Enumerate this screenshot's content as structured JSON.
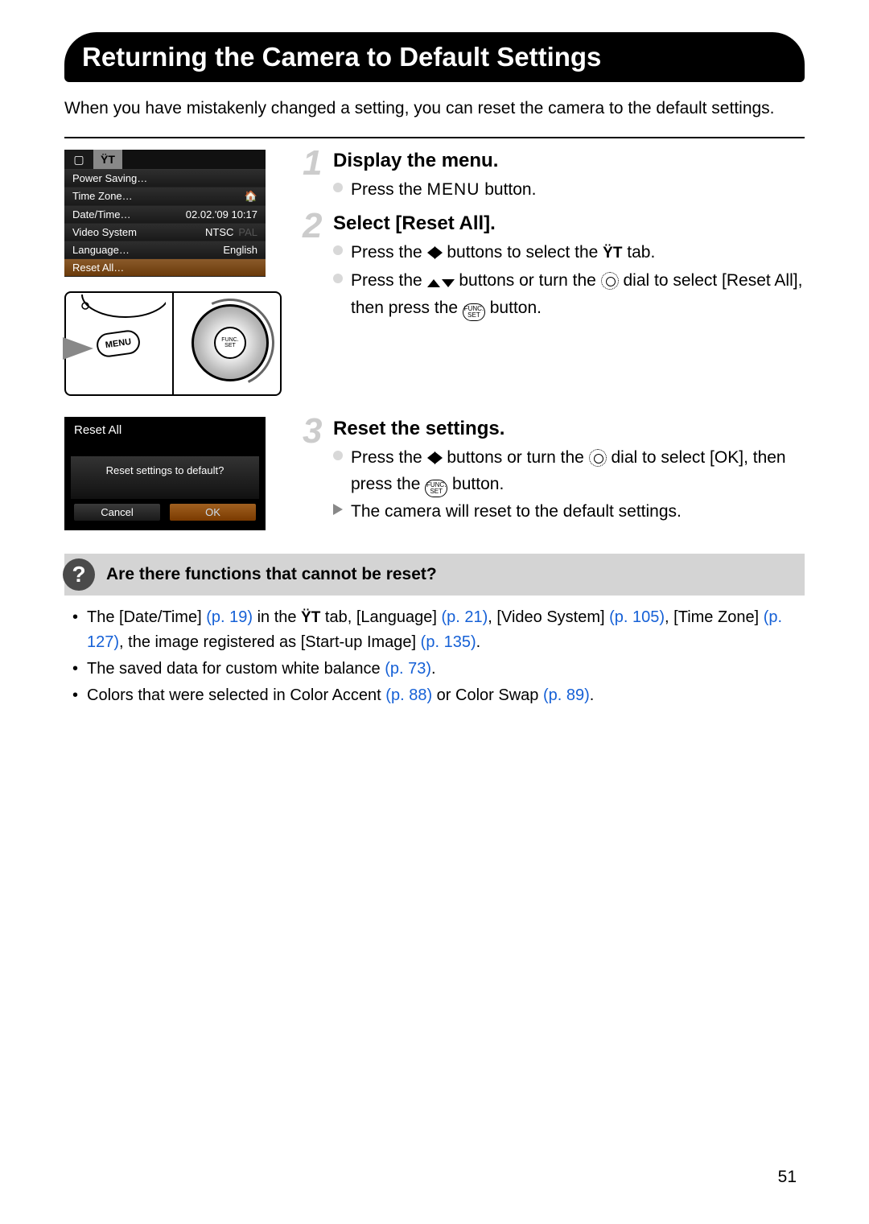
{
  "title": "Returning the Camera to Default Settings",
  "intro": "When you have mistakenly changed a setting, you can reset the camera to the default settings.",
  "page_number": "51",
  "cam_menu": {
    "rows": [
      {
        "label": "Power Saving…",
        "value": ""
      },
      {
        "label": "Time Zone…",
        "value": "🏠"
      },
      {
        "label": "Date/Time…",
        "value": "02.02.'09 10:17"
      },
      {
        "label": "Video System",
        "value": "NTSC",
        "dim": "PAL"
      },
      {
        "label": "Language…",
        "value": "English"
      },
      {
        "label": "Reset All…",
        "value": "",
        "selected": true
      }
    ]
  },
  "hw": {
    "menu_label": "MENU",
    "func_label": "FUNC.\nSET"
  },
  "reset_dialog": {
    "title": "Reset All",
    "question": "Reset settings to default?",
    "cancel": "Cancel",
    "ok": "OK"
  },
  "steps": {
    "s1": {
      "num": "1",
      "title": "Display the menu.",
      "l1a": "Press the ",
      "l1b": "MENU",
      "l1c": " button."
    },
    "s2": {
      "num": "2",
      "title": "Select [Reset All].",
      "l1a": "Press the ",
      "l1b": " buttons to select the ",
      "l1c": " tab.",
      "l2a": "Press the ",
      "l2b": " buttons or turn the ",
      "l2c": " dial to select [Reset All], then press the ",
      "l2d": " button."
    },
    "s3": {
      "num": "3",
      "title": "Reset the settings.",
      "l1a": "Press the ",
      "l1b": " buttons or turn the ",
      "l1c": " dial to select [OK], then press the ",
      "l1d": " button.",
      "l2": "The camera will reset to the default settings."
    }
  },
  "qbox": {
    "title": "Are there functions that cannot be reset?",
    "b1": {
      "t1": "The [Date/Time] ",
      "p1": "(p. 19)",
      "t2": " in the ",
      "t3": " tab, [Language] ",
      "p2": "(p. 21)",
      "t4": ", [Video System] ",
      "p3": "(p. 105)",
      "t5": ", [Time Zone] ",
      "p4": "(p. 127)",
      "t6": ", the image registered as [Start-up Image] ",
      "p5": "(p. 135)",
      "t7": "."
    },
    "b2": {
      "t1": "The saved data for custom white balance ",
      "p1": "(p. 73)",
      "t2": "."
    },
    "b3": {
      "t1": "Colors that were selected in Color Accent ",
      "p1": "(p. 88)",
      "t2": " or Color Swap ",
      "p2": "(p. 89)",
      "t3": "."
    }
  }
}
